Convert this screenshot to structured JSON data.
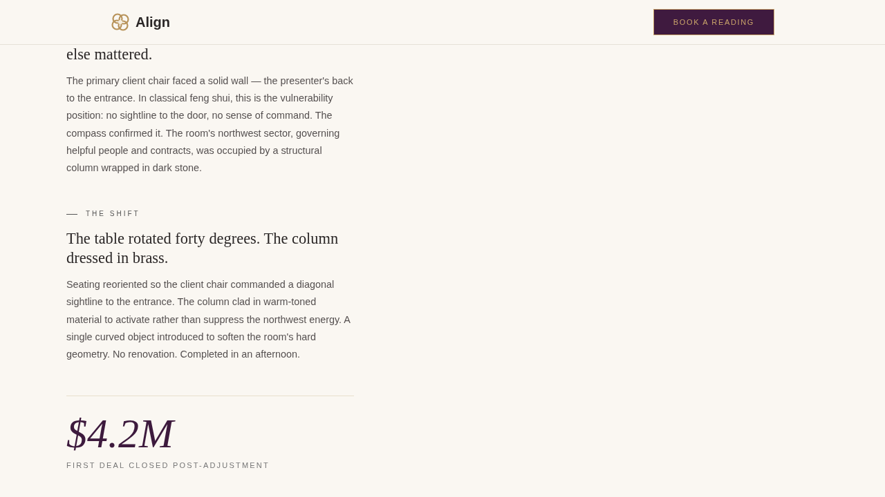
{
  "header": {
    "logo": {
      "name": "Align"
    },
    "cta": {
      "label": "BOOK A READING"
    }
  },
  "sections": [
    {
      "heading": "else mattered.",
      "body": "The primary client chair faced a solid wall — the presenter's back to the entrance. In classical feng shui, this is the vulnerability position: no sightline to the door, no sense of command. The compass confirmed it. The room's northwest sector, governing helpful people and contracts, was occupied by a structural column wrapped in dark stone."
    },
    {
      "eyebrow": "THE SHIFT",
      "heading": "The table rotated forty degrees. The column dressed in brass.",
      "body": "Seating reoriented so the client chair commanded a diagonal sightline to the entrance. The column clad in warm-toned material to activate rather than suppress the northwest energy. A single curved object introduced to soften the room's hard geometry. No renovation. Completed in an afternoon."
    }
  ],
  "stat": {
    "value": "$4.2M",
    "label": "FIRST DEAL CLOSED POST-ADJUSTMENT"
  }
}
